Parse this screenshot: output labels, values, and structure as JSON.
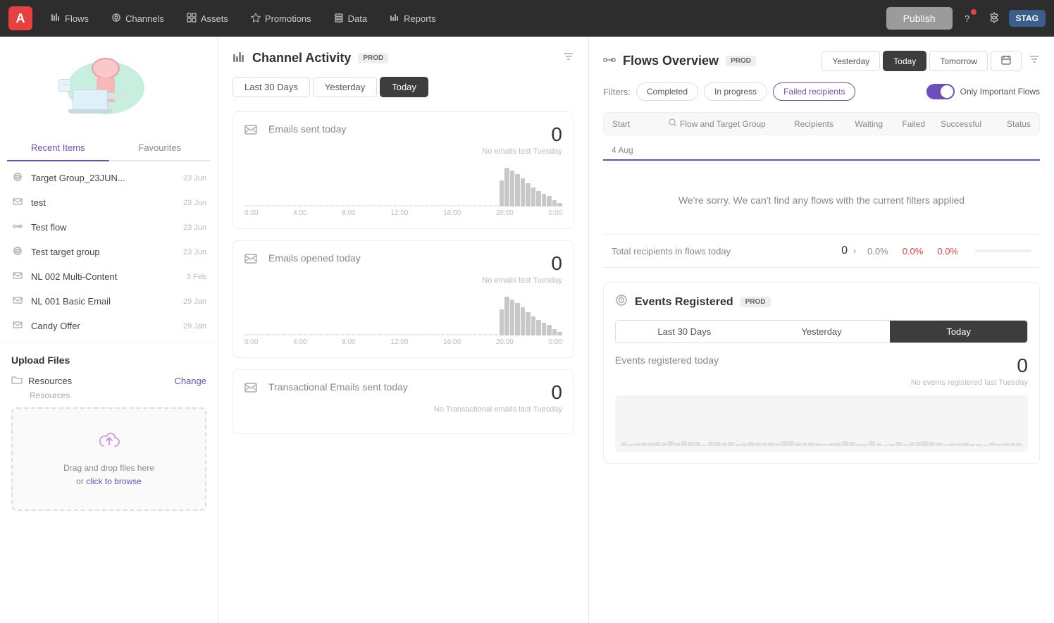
{
  "topnav": {
    "logo": "A",
    "items": [
      {
        "id": "flows",
        "label": "Flows",
        "icon": "⫶"
      },
      {
        "id": "channels",
        "label": "Channels",
        "icon": "◈"
      },
      {
        "id": "assets",
        "label": "Assets",
        "icon": "▦"
      },
      {
        "id": "promotions",
        "label": "Promotions",
        "icon": "◉"
      },
      {
        "id": "data",
        "label": "Data",
        "icon": "◫"
      },
      {
        "id": "reports",
        "label": "Reports",
        "icon": "⎍"
      }
    ],
    "publish_label": "Publish",
    "stag_label": "STAG"
  },
  "sidebar": {
    "tab_recent": "Recent Items",
    "tab_favourites": "Favourites",
    "items": [
      {
        "id": "tg1",
        "icon": "⊕",
        "name": "Target Group_23JUN...",
        "date": "23 Jun"
      },
      {
        "id": "em1",
        "icon": "✉",
        "name": "test",
        "date": "23 Jun"
      },
      {
        "id": "fl1",
        "icon": "→",
        "name": "Test flow",
        "date": "23 Jun"
      },
      {
        "id": "tg2",
        "icon": "⊕",
        "name": "Test target group",
        "date": "23 Jun"
      },
      {
        "id": "em2",
        "icon": "✉",
        "name": "NL 002 Multi-Content",
        "date": "3 Feb"
      },
      {
        "id": "em3",
        "icon": "✉",
        "name": "NL 001 Basic Email",
        "date": "29 Jan"
      },
      {
        "id": "em4",
        "icon": "✉",
        "name": "Candy Offer",
        "date": "29 Jan"
      }
    ],
    "upload_title": "Upload Files",
    "folder_label": "Resources",
    "change_label": "Change",
    "folder_sub": "Resources",
    "dropzone_text1": "Drag and drop files here",
    "dropzone_text2": "or ",
    "dropzone_link": "click to browse"
  },
  "channel_activity": {
    "title": "Channel Activity",
    "badge": "PROD",
    "date_tabs": [
      {
        "id": "30days",
        "label": "Last 30 Days"
      },
      {
        "id": "yesterday",
        "label": "Yesterday"
      },
      {
        "id": "today",
        "label": "Today",
        "active": true
      }
    ],
    "metrics": [
      {
        "id": "emails_sent",
        "label": "Emails sent",
        "period": "today",
        "value": "0",
        "sub": "No emails last Tuesday",
        "chart_labels": [
          "0:00",
          "4:00",
          "8:00",
          "12:00",
          "16:00",
          "20:00",
          "0:00"
        ],
        "bars": [
          1,
          1,
          1,
          1,
          1,
          1,
          1,
          1,
          1,
          1,
          1,
          1,
          1,
          1,
          1,
          1,
          1,
          1,
          1,
          1,
          1,
          1,
          1,
          1,
          1,
          1,
          1,
          1,
          1,
          1,
          1,
          1,
          1,
          1,
          1,
          1,
          1,
          1,
          1,
          1,
          1,
          1,
          1,
          1,
          1,
          1,
          1,
          1,
          20,
          30,
          28,
          25,
          22,
          18,
          15,
          12,
          10,
          8,
          5,
          3
        ]
      },
      {
        "id": "emails_opened",
        "label": "Emails opened",
        "period": "today",
        "value": "0",
        "sub": "No emails last Tuesday",
        "chart_labels": [
          "0:00",
          "4:00",
          "8:00",
          "12:00",
          "16:00",
          "20:00",
          "0:00"
        ],
        "bars": [
          1,
          1,
          1,
          1,
          1,
          1,
          1,
          1,
          1,
          1,
          1,
          1,
          1,
          1,
          1,
          1,
          1,
          1,
          1,
          1,
          1,
          1,
          1,
          1,
          1,
          1,
          1,
          1,
          1,
          1,
          1,
          1,
          1,
          1,
          1,
          1,
          1,
          1,
          1,
          1,
          1,
          1,
          1,
          1,
          1,
          1,
          1,
          1,
          20,
          30,
          28,
          25,
          22,
          18,
          15,
          12,
          10,
          8,
          5,
          3
        ]
      },
      {
        "id": "transactional_emails",
        "label": "Transactional Emails sent",
        "period": "today",
        "value": "0",
        "sub": "No Transactional emails last Tuesday"
      }
    ]
  },
  "flows_overview": {
    "title": "Flows Overview",
    "badge": "PROD",
    "date_tabs": [
      {
        "id": "yesterday",
        "label": "Yesterday"
      },
      {
        "id": "today",
        "label": "Today",
        "active": true
      },
      {
        "id": "tomorrow",
        "label": "Tomorrow"
      }
    ],
    "filters_label": "Filters:",
    "filter_chips": [
      {
        "id": "completed",
        "label": "Completed"
      },
      {
        "id": "in_progress",
        "label": "In progress"
      },
      {
        "id": "failed",
        "label": "Failed recipients",
        "active": true
      }
    ],
    "toggle_label": "Only Important Flows",
    "toggle_on": true,
    "table_headers": {
      "start": "Start",
      "flow": "Flow and Target Group",
      "recipients": "Recipients",
      "waiting": "Waiting",
      "failed": "Failed",
      "successful": "Successful",
      "status": "Status"
    },
    "date_label": "4 Aug",
    "empty_message": "We're sorry. We can't find any flows with the current filters applied",
    "total_label": "Total recipients in flows",
    "total_period": "today",
    "total_count": "0",
    "total_pct1": "0.0%",
    "total_pct2": "0.0%",
    "total_pct3": "0.0%"
  },
  "events_registered": {
    "title": "Events Registered",
    "badge": "PROD",
    "date_tabs": [
      {
        "id": "30days",
        "label": "Last 30 Days"
      },
      {
        "id": "yesterday",
        "label": "Yesterday"
      },
      {
        "id": "today",
        "label": "Today",
        "active": true
      }
    ],
    "metric_label": "Events registered",
    "metric_period": "today",
    "metric_value": "0",
    "metric_sub": "No events registered last Tuesday"
  }
}
